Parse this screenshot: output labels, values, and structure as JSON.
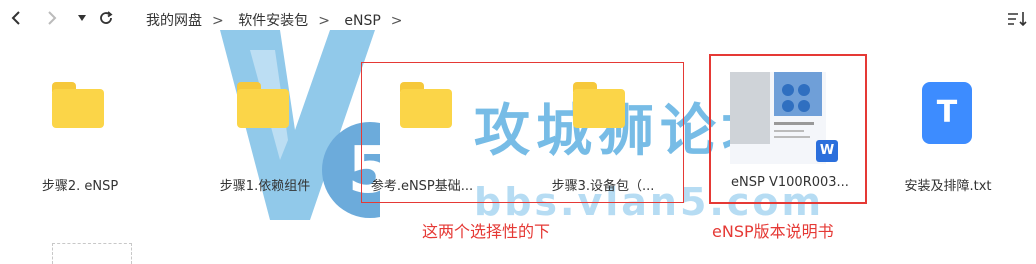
{
  "breadcrumb": [
    "我的网盘",
    "软件安装包",
    "eNSP"
  ],
  "items": [
    {
      "name": "步骤2. eNSP",
      "type": "folder"
    },
    {
      "name": "步骤1.依赖组件",
      "type": "folder"
    },
    {
      "name": "参考.eNSP基础...",
      "type": "folder"
    },
    {
      "name": "步骤3.设备包（...",
      "type": "folder"
    },
    {
      "name": "eNSP V100R003...",
      "type": "word-doc"
    },
    {
      "name": "安装及排障.txt",
      "type": "txt"
    }
  ],
  "annotations": {
    "selection_note": "这两个选择性的下",
    "manual_note": "eNSP版本说明书"
  },
  "watermark": {
    "text": "攻城狮论坛",
    "url": "bbs.vlan5.com",
    "badge": "5"
  },
  "colors": {
    "accent_red": "#e53935",
    "folder": "#fbd548",
    "txt_blue": "#3d8cff",
    "watermark": "#4aa6de"
  },
  "icons": {
    "back": "chevron-left-icon",
    "forward": "chevron-right-icon",
    "dropdown": "caret-down-icon",
    "refresh": "refresh-icon",
    "sort": "sort-icon",
    "word": "word-icon",
    "txt_letter": "T"
  }
}
